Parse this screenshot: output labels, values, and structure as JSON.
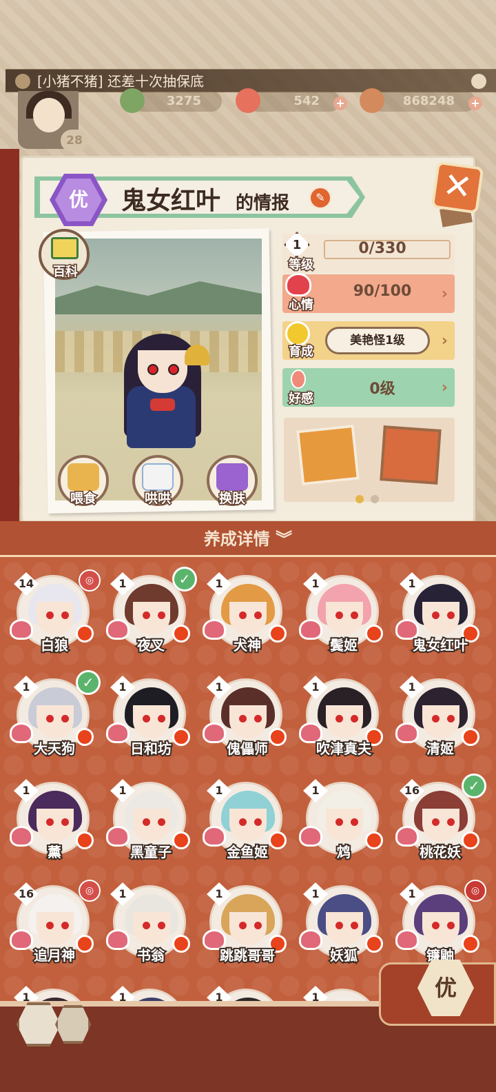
{
  "announcement": "[小猪不猪] 还差十次抽保底",
  "player": {
    "level": "28"
  },
  "resources": [
    {
      "name": "jade",
      "value": "3275"
    },
    {
      "name": "stamina",
      "value": "542"
    },
    {
      "name": "coins",
      "value": "868248"
    }
  ],
  "info": {
    "rarity": "优",
    "name": "鬼女红叶",
    "name_suffix": "的情报",
    "encyclopedia_label": "百科",
    "actions": [
      "喂食",
      "哄哄",
      "换肤"
    ]
  },
  "stats": {
    "level": {
      "label": "等级",
      "badge": "1",
      "value": "0/330"
    },
    "mood": {
      "label": "心情",
      "value": "90/100"
    },
    "growth": {
      "label": "育成",
      "value": "美艳怪1级"
    },
    "affection": {
      "label": "好感",
      "value": "0级"
    }
  },
  "colors": {
    "mood": "#f2a98c",
    "growth": "#f3d28a",
    "affection": "#9dd3ae",
    "accent": "#c2603d"
  },
  "section_title": "养成详情",
  "characters": [
    {
      "name": "白狼",
      "level": "14",
      "hair": "#e8e6ee",
      "badge": "deco"
    },
    {
      "name": "夜叉",
      "level": "1",
      "hair": "#6e3b2e",
      "badge": "check"
    },
    {
      "name": "犬神",
      "level": "1",
      "hair": "#e39a45",
      "badge": ""
    },
    {
      "name": "鬓姬",
      "level": "1",
      "hair": "#f3a3ad",
      "badge": ""
    },
    {
      "name": "鬼女红叶",
      "level": "1",
      "hair": "#272235",
      "badge": ""
    },
    {
      "name": "大天狗",
      "level": "1",
      "hair": "#c9cbd6",
      "badge": "check"
    },
    {
      "name": "日和坊",
      "level": "1",
      "hair": "#1f1d24",
      "badge": ""
    },
    {
      "name": "傀儡师",
      "level": "1",
      "hair": "#5a2f2a",
      "badge": ""
    },
    {
      "name": "吹津真夫",
      "level": "1",
      "hair": "#2a2126",
      "badge": ""
    },
    {
      "name": "清姬",
      "level": "1",
      "hair": "#2c2230",
      "badge": ""
    },
    {
      "name": "薰",
      "level": "1",
      "hair": "#4b2a5c",
      "badge": ""
    },
    {
      "name": "黑童子",
      "level": "1",
      "hair": "#ece9e4",
      "badge": ""
    },
    {
      "name": "金鱼姬",
      "level": "1",
      "hair": "#8fd1d4",
      "badge": ""
    },
    {
      "name": "鸩",
      "level": "1",
      "hair": "#f2efe7",
      "badge": ""
    },
    {
      "name": "桃花妖",
      "level": "16",
      "hair": "#8a3e36",
      "badge": "check"
    },
    {
      "name": "追月神",
      "level": "16",
      "hair": "#f4f1ee",
      "badge": "deco"
    },
    {
      "name": "书翁",
      "level": "1",
      "hair": "#e9e6df",
      "badge": ""
    },
    {
      "name": "跳跳哥哥",
      "level": "1",
      "hair": "#d8a55a",
      "badge": ""
    },
    {
      "name": "妖狐",
      "level": "1",
      "hair": "#4a4e84",
      "badge": ""
    },
    {
      "name": "镰鼬",
      "level": "1",
      "hair": "#5b3f7c",
      "badge": "deco2"
    },
    {
      "name": "",
      "level": "1",
      "hair": "#3a2a30",
      "badge": ""
    },
    {
      "name": "",
      "level": "1",
      "hair": "#3d4068",
      "badge": ""
    },
    {
      "name": "",
      "level": "1",
      "hair": "#2e2a2a",
      "badge": ""
    },
    {
      "name": "",
      "level": "1",
      "hair": "#f2eee8",
      "badge": ""
    }
  ],
  "filter": {
    "label": "优"
  }
}
